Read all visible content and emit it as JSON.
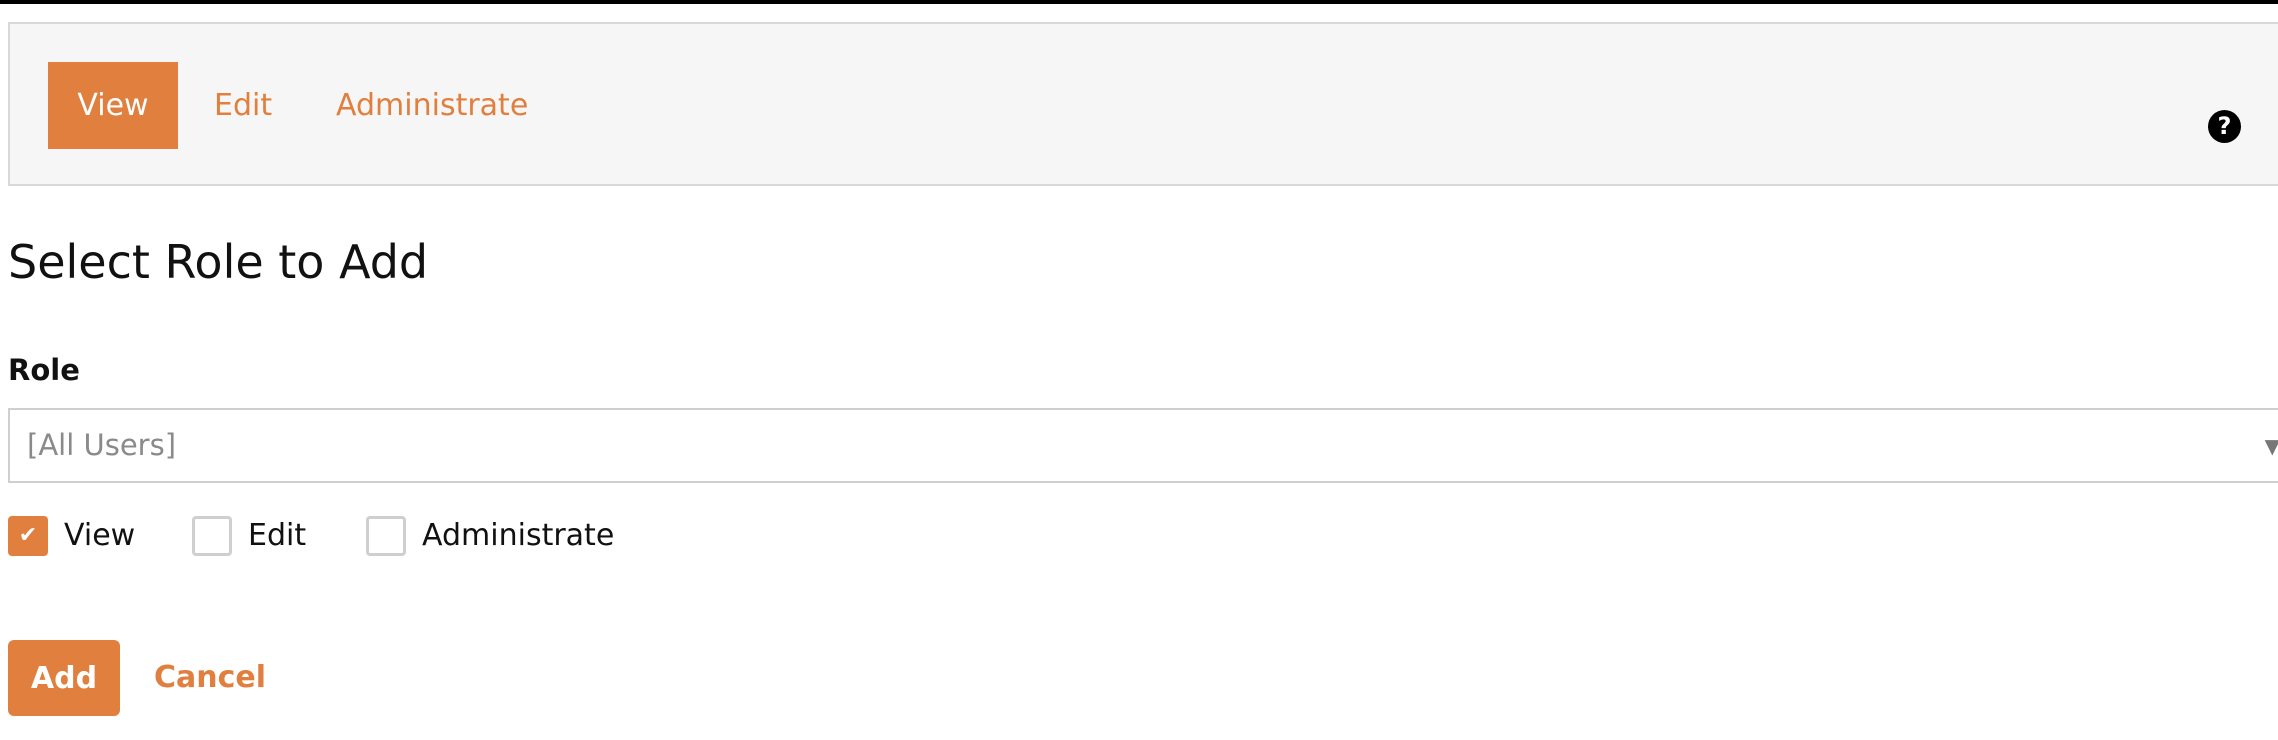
{
  "tabs": [
    {
      "label": "View",
      "active": true
    },
    {
      "label": "Edit",
      "active": false
    },
    {
      "label": "Administrate",
      "active": false
    }
  ],
  "help": {
    "icon": "question-circle-icon",
    "glyph": "?"
  },
  "page_title": "Select Role to Add",
  "role_field": {
    "label": "Role",
    "selected": "[All Users]",
    "caret_icon": "chevron-down-icon"
  },
  "permissions": [
    {
      "label": "View",
      "checked": true
    },
    {
      "label": "Edit",
      "checked": false
    },
    {
      "label": "Administrate",
      "checked": false
    }
  ],
  "actions": {
    "add_label": "Add",
    "cancel_label": "Cancel"
  },
  "colors": {
    "accent": "#e07f3e",
    "tabbar_bg": "#f6f6f6",
    "border": "#d8d8d8"
  }
}
